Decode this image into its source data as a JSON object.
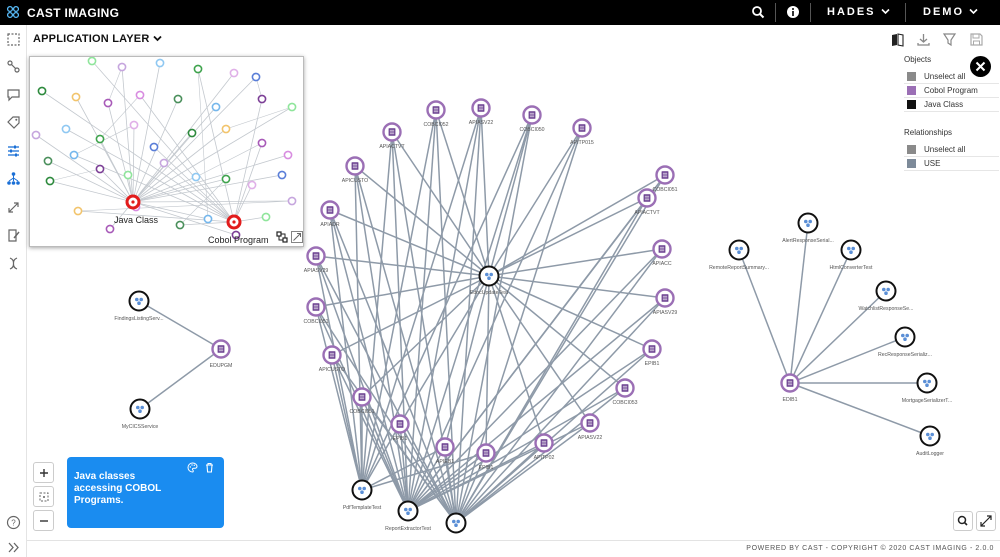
{
  "app": {
    "title": "CAST IMAGING"
  },
  "topbar": {
    "menu1": "HADES",
    "menu2": "DEMO"
  },
  "toolbar": {
    "layer_label": "APPLICATION LAYER"
  },
  "legend": {
    "objects_title": "Objects",
    "objects": [
      {
        "label": "Unselect all",
        "color": "#8a8a8a"
      },
      {
        "label": "Cobol Program",
        "color": "#9b6fb5"
      },
      {
        "label": "Java Class",
        "color": "#111111"
      }
    ],
    "relationships_title": "Relationships",
    "relationships": [
      {
        "label": "Unselect all",
        "color": "#8a8a8a"
      },
      {
        "label": "USE",
        "color": "#7d8a99"
      }
    ]
  },
  "minimap": {
    "label_java": "Java Class",
    "label_cobol": "Cobol Program"
  },
  "note": {
    "text": "Java classes accessing COBOL Programs."
  },
  "footer": {
    "text": "POWERED BY CAST - COPYRIGHT © 2020 CAST IMAGING - 2.0.0"
  },
  "graph": {
    "nodes": [
      {
        "id": "c1",
        "type": "cobol",
        "label": "COBCI052"
      },
      {
        "id": "c2",
        "type": "cobol",
        "label": "APIASV22"
      },
      {
        "id": "c3",
        "type": "cobol",
        "label": "COBCI050"
      },
      {
        "id": "c4",
        "type": "cobol",
        "label": "APITP015"
      },
      {
        "id": "c5",
        "type": "cobol",
        "label": "APIACTVT"
      },
      {
        "id": "c6",
        "type": "cobol",
        "label": "APICUSTO"
      },
      {
        "id": "c7",
        "type": "cobol",
        "label": "APIADR"
      },
      {
        "id": "c8",
        "type": "cobol",
        "label": "APIASV29"
      },
      {
        "id": "c9",
        "type": "cobol",
        "label": "COBCI051"
      },
      {
        "id": "c10",
        "type": "cobol",
        "label": "APICUSTO"
      },
      {
        "id": "c11",
        "type": "cobol",
        "label": "COBCI051"
      },
      {
        "id": "c12",
        "type": "cobol",
        "label": "EPIB1"
      },
      {
        "id": "c13",
        "type": "cobol",
        "label": "APIEB1"
      },
      {
        "id": "c14",
        "type": "cobol",
        "label": "EPIB1"
      },
      {
        "id": "c15",
        "type": "cobol",
        "label": "APITP02"
      },
      {
        "id": "c16",
        "type": "cobol",
        "label": "APIASV22"
      },
      {
        "id": "c17",
        "type": "cobol",
        "label": "COBCI053"
      },
      {
        "id": "c18",
        "type": "cobol",
        "label": "EPIB1"
      },
      {
        "id": "c19",
        "type": "cobol",
        "label": "APIASV29"
      },
      {
        "id": "c20",
        "type": "cobol",
        "label": "APIACC"
      },
      {
        "id": "c21",
        "type": "cobol",
        "label": "APIACTVT"
      },
      {
        "id": "c22",
        "type": "cobol",
        "label": "COBCI051"
      },
      {
        "id": "c23",
        "type": "cobol",
        "label": "EDUPGM"
      },
      {
        "id": "c24",
        "type": "cobol",
        "label": "EDIB1"
      },
      {
        "id": "j1",
        "type": "java",
        "label": "EdocUpdateTest"
      },
      {
        "id": "j2",
        "type": "java",
        "label": "PdfTemplateTest"
      },
      {
        "id": "j3",
        "type": "java",
        "label": "ReportExtractorTest"
      },
      {
        "id": "j4",
        "type": "java",
        "label": ""
      },
      {
        "id": "j5",
        "type": "java",
        "label": "FindingsListingServ..."
      },
      {
        "id": "j6",
        "type": "java",
        "label": "MyCICSService"
      },
      {
        "id": "j7",
        "type": "java",
        "label": "RemoteReportSummary..."
      },
      {
        "id": "j8",
        "type": "java",
        "label": "AlertResponseSerial..."
      },
      {
        "id": "j9",
        "type": "java",
        "label": "HtmlConverterTest"
      },
      {
        "id": "j10",
        "type": "java",
        "label": "WatchlistResponseSe..."
      },
      {
        "id": "j11",
        "type": "java",
        "label": "RecResponseSerializ..."
      },
      {
        "id": "j12",
        "type": "java",
        "label": "MortgageSerializerT..."
      },
      {
        "id": "j13",
        "type": "java",
        "label": "AuditLogger"
      }
    ]
  }
}
